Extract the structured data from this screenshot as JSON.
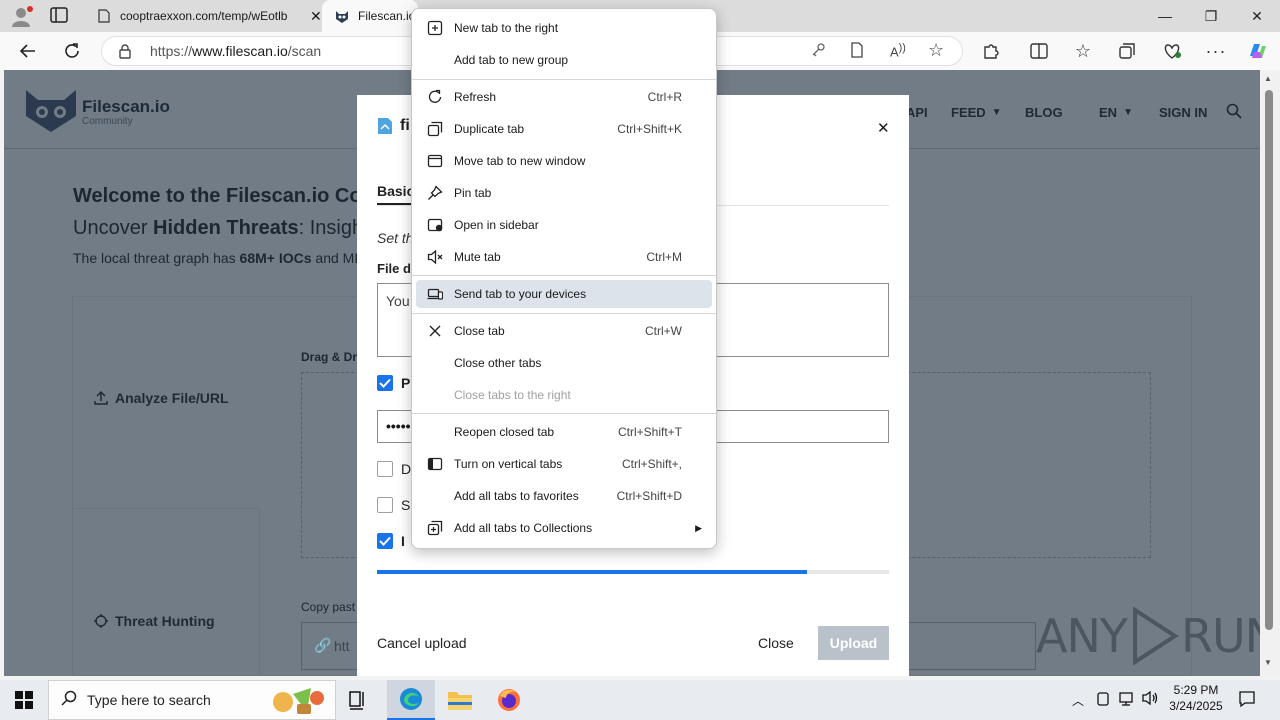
{
  "browser": {
    "tabs": [
      {
        "title": "cooptraexxon.com/temp/wEotlb",
        "active": false
      },
      {
        "title": "Filescan.io",
        "active": true
      }
    ],
    "url_prefix": "https://",
    "url_host": "www.filescan.io",
    "url_path": "/scan"
  },
  "site": {
    "logo_name": "Filescan.io",
    "logo_sub": "Community",
    "nav": [
      "API",
      "FEED",
      "BLOG",
      "EN",
      "SIGN IN"
    ],
    "welcome": "Welcome to the Filescan.io Com",
    "tagline_a": "Uncover ",
    "tagline_b": "Hidden Threats",
    "tagline_c": ": Insight",
    "graph_text_a": "The local threat graph has ",
    "graph_text_b": "68M+ IOCs",
    "graph_text_c": " and MD",
    "sidebar_analyze": "Analyze File/URL",
    "sidebar_hunting": "Threat Hunting",
    "drag_label": "Drag & Dr",
    "copy_label": "Copy past",
    "url_input_partial": "htt"
  },
  "modal": {
    "title_partial": "fi",
    "tab_basic": "Basic",
    "set_the": "Set th",
    "file_desc_label": "File de",
    "textarea_partial": "You",
    "checkbox_p": "P",
    "password_dots": "•••••",
    "checkbox_d": "D",
    "checkbox_s": "S",
    "checkbox_i": "I",
    "progress": 0.84,
    "cancel_upload": "Cancel upload",
    "close": "Close",
    "upload": "Upload"
  },
  "context_menu": {
    "items": [
      {
        "label": "New tab to the right",
        "shortcut": ""
      },
      {
        "label": "Add tab to new group",
        "shortcut": ""
      },
      {
        "label": "Refresh",
        "shortcut": "Ctrl+R"
      },
      {
        "label": "Duplicate tab",
        "shortcut": "Ctrl+Shift+K"
      },
      {
        "label": "Move tab to new window",
        "shortcut": ""
      },
      {
        "label": "Pin tab",
        "shortcut": ""
      },
      {
        "label": "Open in sidebar",
        "shortcut": ""
      },
      {
        "label": "Mute tab",
        "shortcut": "Ctrl+M"
      },
      {
        "label": "Send tab to your devices",
        "shortcut": ""
      },
      {
        "label": "Close tab",
        "shortcut": "Ctrl+W"
      },
      {
        "label": "Close other tabs",
        "shortcut": ""
      },
      {
        "label": "Close tabs to the right",
        "shortcut": ""
      },
      {
        "label": "Reopen closed tab",
        "shortcut": "Ctrl+Shift+T"
      },
      {
        "label": "Turn on vertical tabs",
        "shortcut": "Ctrl+Shift+,"
      },
      {
        "label": "Add all tabs to favorites",
        "shortcut": "Ctrl+Shift+D"
      },
      {
        "label": "Add all tabs to Collections",
        "shortcut": ""
      }
    ]
  },
  "watermark": {
    "left": "ANY",
    "right": "RUN"
  },
  "taskbar": {
    "search_placeholder": "Type here to search",
    "time": "5:29 PM",
    "date": "3/24/2025"
  }
}
